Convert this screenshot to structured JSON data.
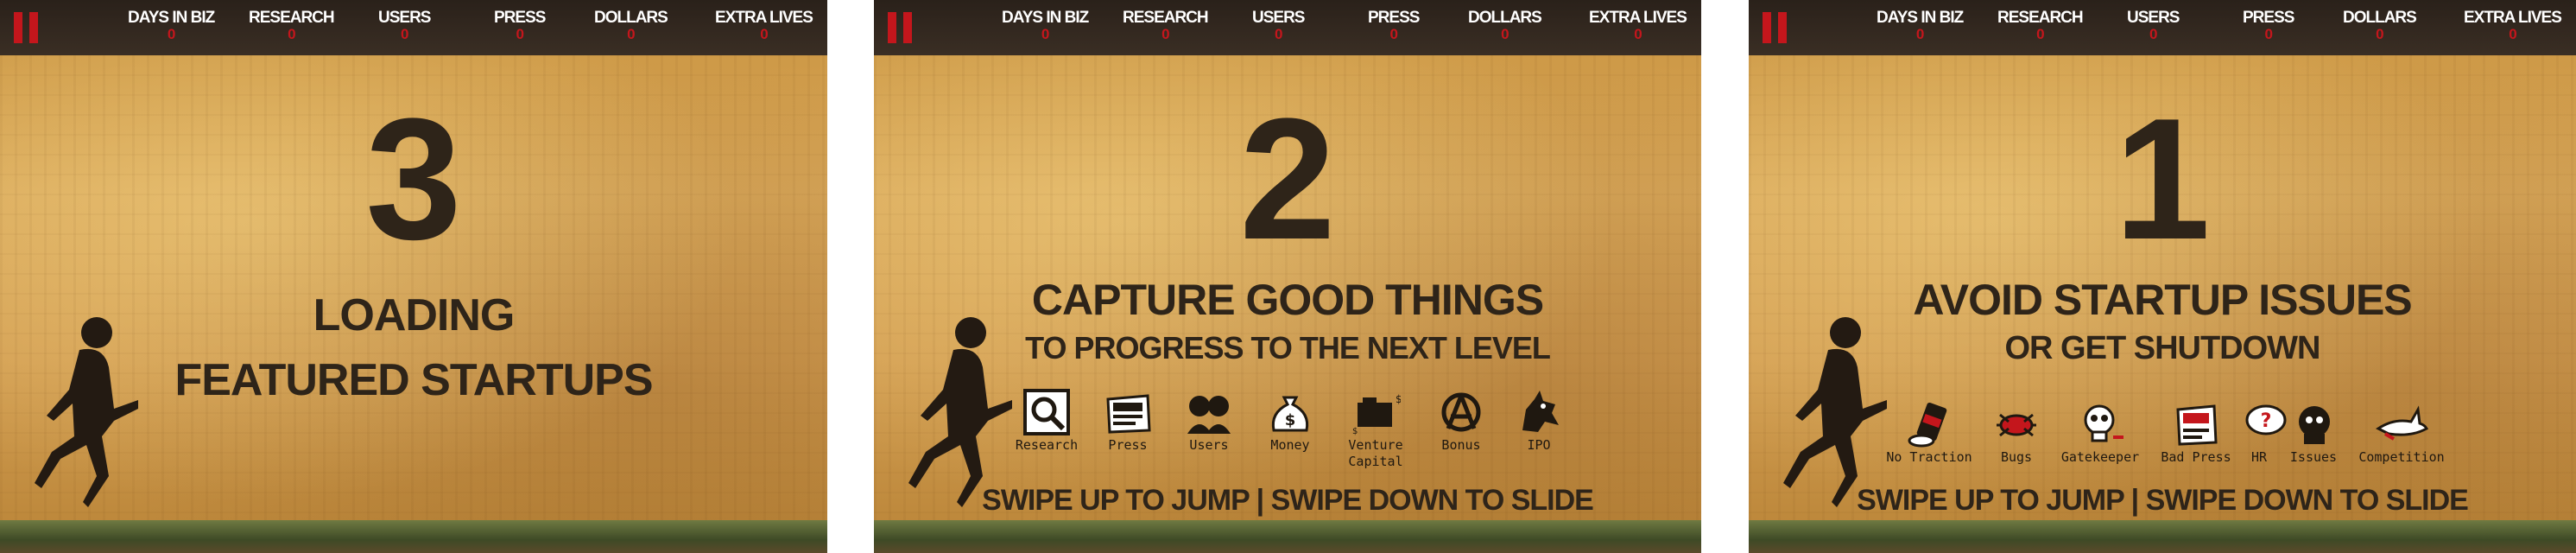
{
  "stats": [
    {
      "label": "DAYS IN BIZ",
      "value": "0"
    },
    {
      "label": "RESEARCH",
      "value": "0"
    },
    {
      "label": "USERS",
      "value": "0"
    },
    {
      "label": "PRESS",
      "value": "0"
    },
    {
      "label": "DOLLARS",
      "value": "0"
    },
    {
      "label": "EXTRA LIVES",
      "value": "0"
    }
  ],
  "panel1": {
    "number": "3",
    "line1": "LOADING",
    "line2": "FEATURED STARTUPS"
  },
  "panel2": {
    "number": "2",
    "line1": "CAPTURE GOOD THINGS",
    "line2": "TO PROGRESS TO THE NEXT LEVEL",
    "items": [
      {
        "label": "Research",
        "icon": "magnifier-icon"
      },
      {
        "label": "Press",
        "icon": "good-press-icon"
      },
      {
        "label": "Users",
        "icon": "users-icon"
      },
      {
        "label": "Money",
        "icon": "money-bag-icon"
      },
      {
        "label": "Venture\nCapital",
        "icon": "venture-capital-icon"
      },
      {
        "label": "Bonus",
        "icon": "bonus-icon"
      },
      {
        "label": "IPO",
        "icon": "ipo-icon"
      }
    ],
    "swipe_up": "SWIPE UP TO JUMP",
    "swipe_down": "SWIPE DOWN TO SLIDE"
  },
  "panel3": {
    "number": "1",
    "line1": "AVOID STARTUP ISSUES",
    "line2": "OR GET SHUTDOWN",
    "items": [
      {
        "label": "No Traction",
        "icon": "no-traction-icon"
      },
      {
        "label": "Bugs",
        "icon": "bug-icon"
      },
      {
        "label": "Gatekeeper",
        "icon": "gatekeeper-skull-icon"
      },
      {
        "label": "Bad Press",
        "icon": "bad-press-icon"
      },
      {
        "label": "HR",
        "icon": "hr-question-icon"
      },
      {
        "label": "Issues",
        "icon": "issues-icon"
      },
      {
        "label": "Competition",
        "icon": "shark-icon"
      }
    ],
    "swipe_up": "SWIPE UP TO JUMP",
    "swipe_down": "SWIPE DOWN TO SLIDE"
  },
  "colors": {
    "accent": "#c4161c",
    "ink": "#2e2419",
    "wall": "#d2a052",
    "bar": "#2f261e"
  }
}
